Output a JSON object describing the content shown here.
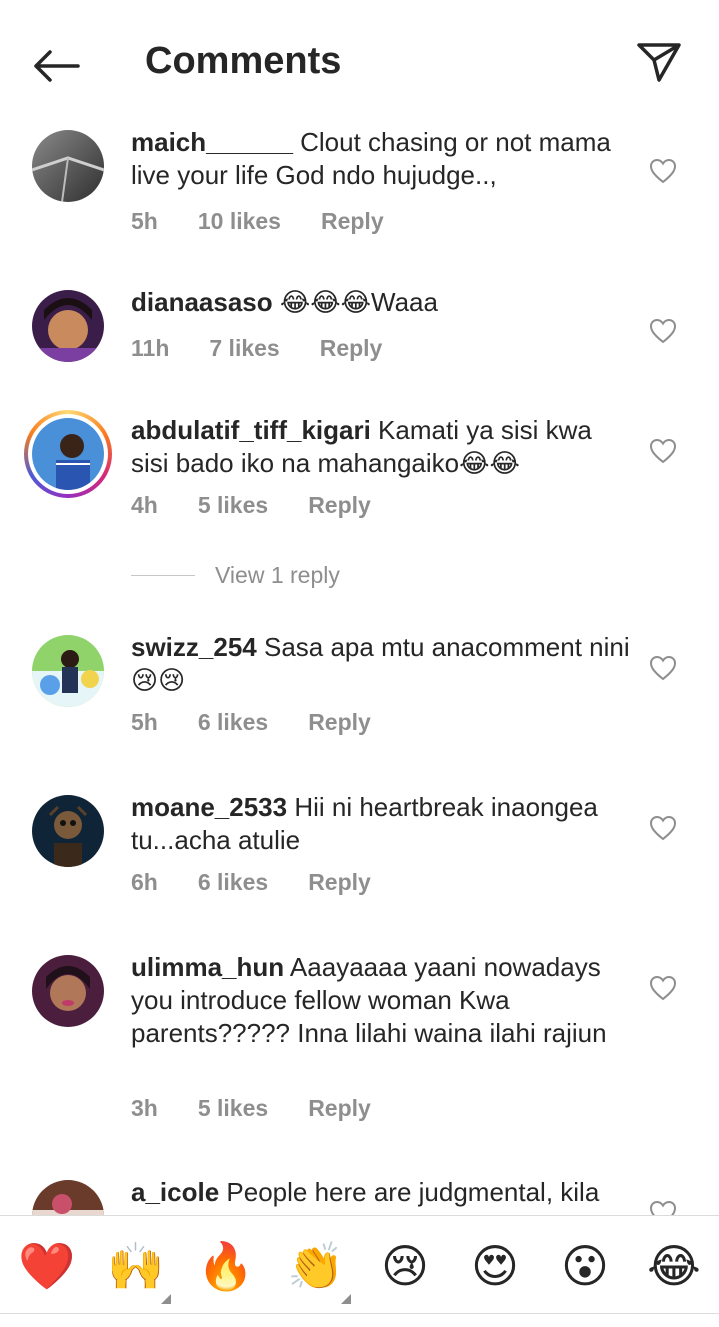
{
  "header": {
    "title": "Comments",
    "back_icon": "arrow-left-icon",
    "share_icon": "paper-plane-icon"
  },
  "comments": [
    {
      "username": "maich______",
      "text": " Clout chasing or not mama live your life God ndo hujudge..,",
      "time": "5h",
      "likes": "10 likes",
      "reply": "Reply"
    },
    {
      "username": "dianaasaso",
      "text": " 😂😂😂Waaa",
      "time": "11h",
      "likes": "7 likes",
      "reply": "Reply"
    },
    {
      "username": "abdulatif_tiff_kigari",
      "text": " Kamati ya sisi kwa sisi bado iko na mahangaiko😂😂",
      "time": "4h",
      "likes": "5 likes",
      "reply": "Reply"
    },
    {
      "username": "swizz_254",
      "text": " Sasa apa mtu anacomment nini😢😢",
      "time": "5h",
      "likes": "6 likes",
      "reply": "Reply"
    },
    {
      "username": "moane_2533",
      "text": " Hii ni heartbreak inaongea tu...acha atulie",
      "time": "6h",
      "likes": "6 likes",
      "reply": "Reply"
    },
    {
      "username": "ulimma_hun",
      "text": " Aaayaaaa yaani nowadays you introduce fellow woman Kwa parents????? Inna lilahi waina ilahi rajiun",
      "time": "3h",
      "likes": "5 likes",
      "reply": "Reply"
    },
    {
      "username": "a_icole",
      "text": " People here are judgmental, kila",
      "time": "",
      "likes": "",
      "reply": ""
    }
  ],
  "view_reply": "View 1 reply",
  "emoji_bar": [
    "❤️",
    "🙌",
    "🔥",
    "👏",
    "😢",
    "😍",
    "😮",
    "😂"
  ],
  "colors": {
    "text": "#262626",
    "muted": "#8e8e8e",
    "divider": "#dbdbdb",
    "heart": "#e0245e"
  }
}
